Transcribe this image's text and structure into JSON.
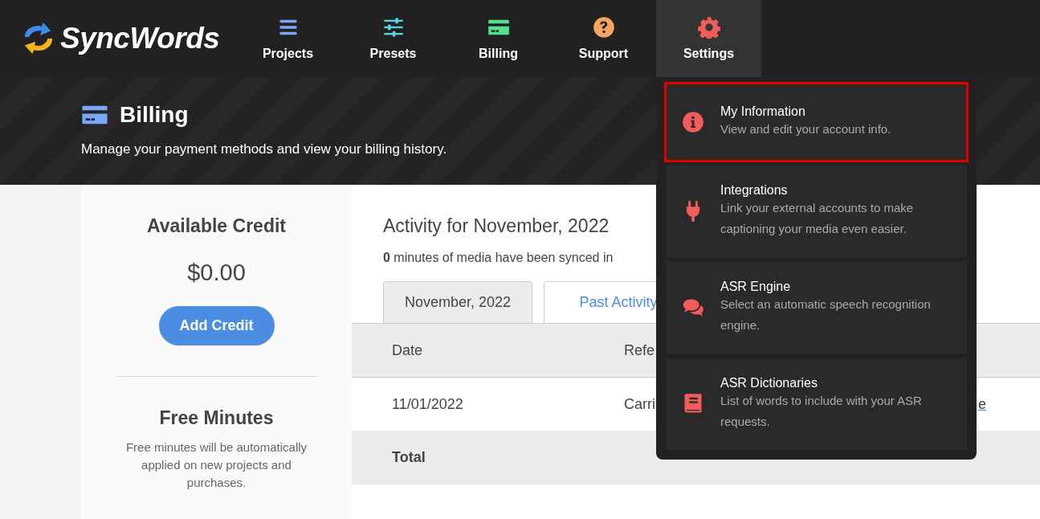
{
  "logo": {
    "text": "SyncWords"
  },
  "nav": [
    {
      "label": "Projects",
      "color": "#7ba7f7",
      "selected": false
    },
    {
      "label": "Presets",
      "color": "#4fd9e6",
      "selected": false
    },
    {
      "label": "Billing",
      "color": "#52e08e",
      "selected": false
    },
    {
      "label": "Support",
      "color": "#f6a55e",
      "selected": false
    },
    {
      "label": "Settings",
      "color": "#f25c5c",
      "selected": true
    }
  ],
  "header": {
    "title": "Billing",
    "subtitle": "Manage your payment methods and view your billing history."
  },
  "credit": {
    "title": "Available Credit",
    "amount": "$0.00",
    "button": "Add Credit"
  },
  "free_minutes": {
    "title": "Free Minutes",
    "text": "Free minutes will be automatically applied on new projects and purchases."
  },
  "activity": {
    "title": "Activity for November, 2022",
    "summary": "**0** minutes of media have been synced in",
    "tabs": [
      {
        "label": "November, 2022",
        "selected": true
      },
      {
        "label": "Past Activity",
        "selected": false
      }
    ],
    "table": {
      "columns": [
        "Date",
        "Refe"
      ],
      "rows": [
        {
          "cells": [
            "11/01/2022",
            "Carri"
          ],
          "link": "e"
        }
      ],
      "total": "Total"
    }
  },
  "settings_menu": {
    "items": [
      {
        "title": "My Information",
        "description": "View and edit your account info.",
        "highlighted": true
      },
      {
        "title": "Integrations",
        "description": "Link your external accounts to make captioning your media even easier.",
        "highlighted": false
      },
      {
        "title": "ASR Engine",
        "description": "Select an automatic speech recognition engine.",
        "highlighted": false
      },
      {
        "title": "ASR Dictionaries",
        "description": "List of words to include with your ASR requests.",
        "highlighted": false
      }
    ]
  }
}
